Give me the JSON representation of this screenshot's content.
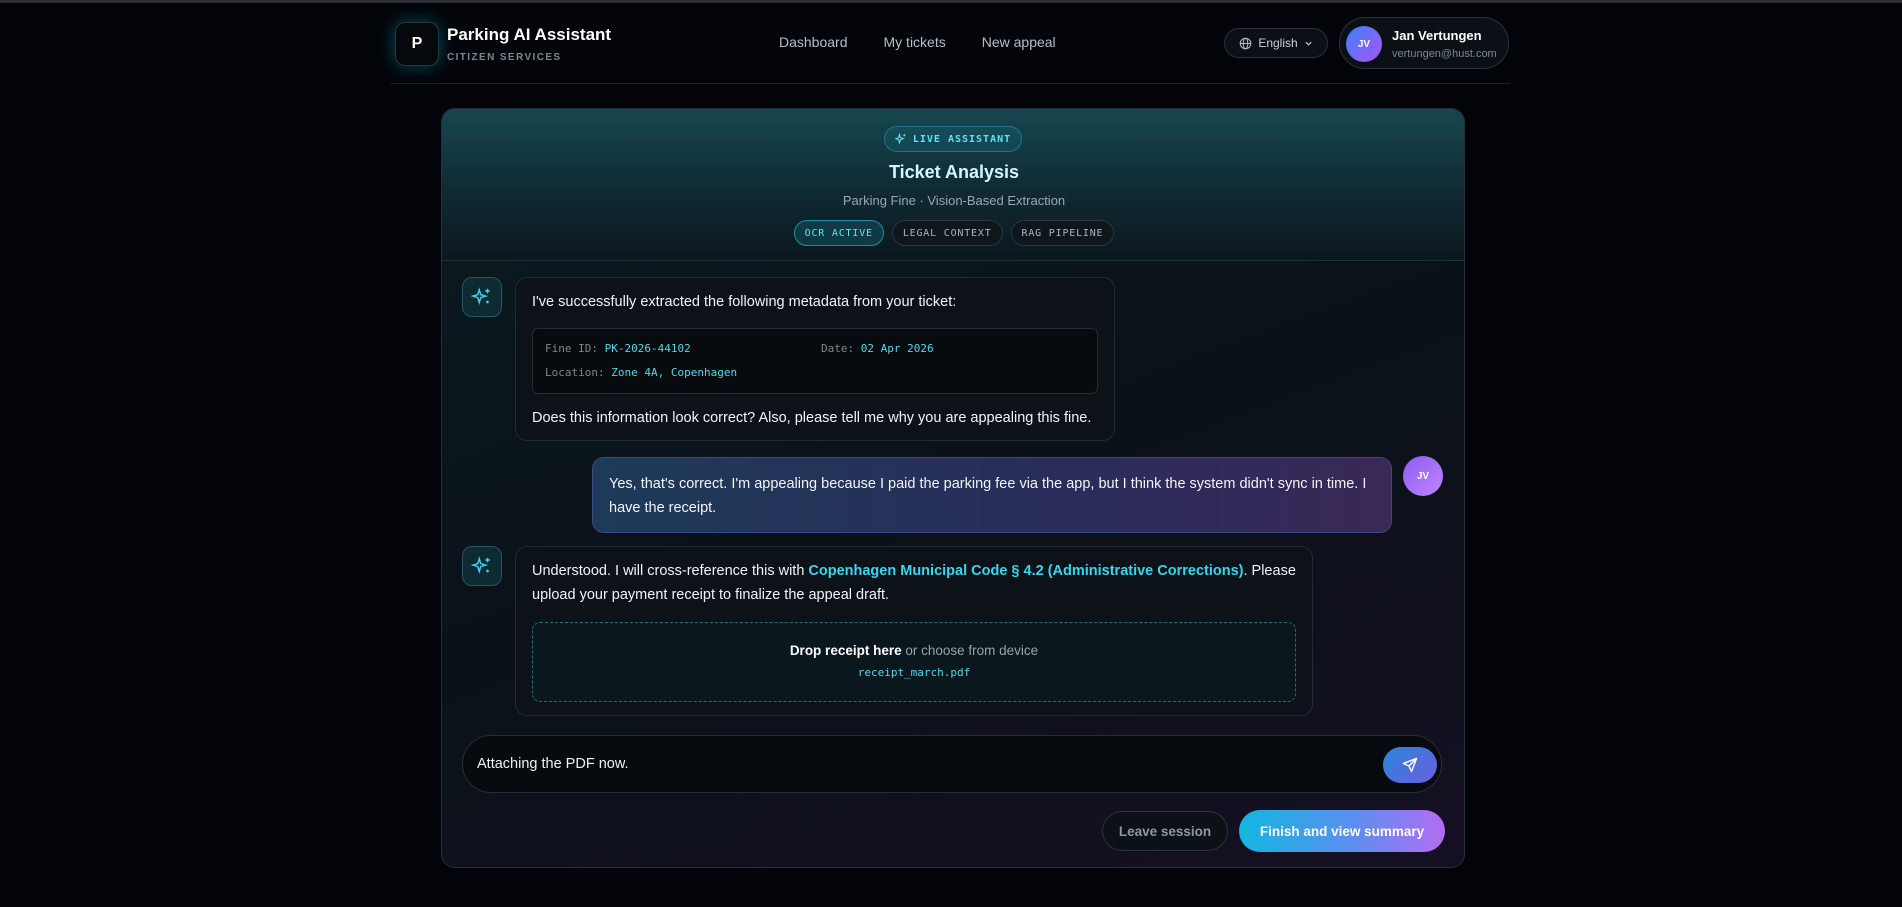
{
  "brand": {
    "logo_letter": "P",
    "title": "Parking AI Assistant",
    "subtitle": "CITIZEN SERVICES"
  },
  "nav": {
    "items": [
      "Dashboard",
      "My tickets",
      "New appeal"
    ]
  },
  "language": {
    "label": "English",
    "icon": "globe-icon"
  },
  "user": {
    "initials": "JV",
    "name": "Jan Vertungen",
    "email": "vertungen@hust.com"
  },
  "card": {
    "badge": "LIVE ASSISTANT",
    "title": "Ticket Analysis",
    "subtitle": "Parking Fine · Vision-Based Extraction",
    "pills": [
      "OCR ACTIVE",
      "LEGAL CONTEXT",
      "RAG PIPELINE"
    ]
  },
  "messages": {
    "bot1": {
      "intro": "I've successfully extracted the following metadata from your ticket:",
      "fine_id_label": "Fine ID:",
      "fine_id": "PK-2026-44102",
      "date_label": "Date:",
      "date": "02 Apr 2026",
      "location_label": "Location:",
      "location": "Zone 4A, Copenhagen",
      "question": "Does this information look correct? Also, please tell me why you are appealing this fine."
    },
    "user1": {
      "initials": "JV",
      "text": "Yes, that's correct. I'm appealing because I paid the parking fee via the app, but I think the system didn't sync in time. I have the receipt."
    },
    "bot2": {
      "text_before": "Understood. I will cross-reference this with ",
      "link": "Copenhagen Municipal Code § 4.2 (Administrative Corrections)",
      "text_after": ". Please upload your payment receipt to finalize the appeal draft.",
      "drop_bold": "Drop receipt here",
      "drop_rest": " or choose from device",
      "file_name": "receipt_march.pdf"
    }
  },
  "composer": {
    "value": "Attaching the PDF now.",
    "send_icon": "send-icon"
  },
  "actions": {
    "leave": "Leave session",
    "finish": "Finish and view summary"
  },
  "colors": {
    "accent_cyan": "#38d6f0",
    "accent_purple": "#a855f7",
    "background": "#020409"
  }
}
